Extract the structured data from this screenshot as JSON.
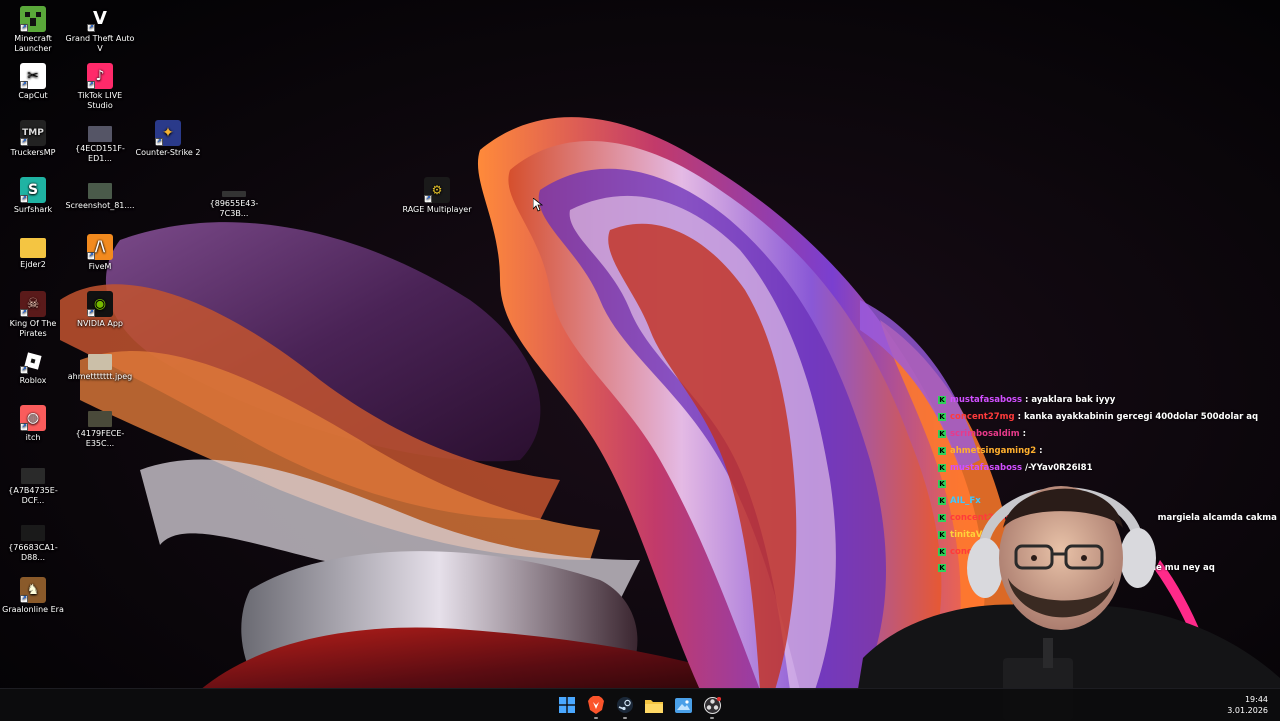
{
  "desktop": {
    "icons": [
      {
        "label": "Minecraft Launcher",
        "icon": "minecraft-icon"
      },
      {
        "label": "Grand Theft Auto V",
        "icon": "gta5-icon"
      },
      {
        "label": "CapCut",
        "icon": "capcut-icon"
      },
      {
        "label": "TikTok LIVE Studio",
        "icon": "tiktok-live-icon"
      },
      {
        "label": "TruckersMP",
        "icon": "truckersmp-icon"
      },
      {
        "label": "{4ECD151F-ED1...",
        "icon": "image-file-icon"
      },
      {
        "label": "Counter-Strike 2",
        "icon": "cs2-icon"
      },
      {
        "label": "Surfshark",
        "icon": "surfshark-icon"
      },
      {
        "label": "Screenshot_81....",
        "icon": "image-file-icon"
      },
      {
        "label": "{89655E43-7C3B...",
        "icon": "image-file-icon"
      },
      {
        "label": "RAGE Multiplayer",
        "icon": "rage-mp-icon"
      },
      {
        "label": "Ejder2",
        "icon": "folder-icon"
      },
      {
        "label": "FiveM",
        "icon": "fivem-icon"
      },
      {
        "label": "King Of The Pirates",
        "icon": "king-of-pirates-icon"
      },
      {
        "label": "NVIDIA App",
        "icon": "nvidia-icon"
      },
      {
        "label": "Roblox",
        "icon": "roblox-icon"
      },
      {
        "label": "ahmettttttt.jpeg",
        "icon": "image-file-icon"
      },
      {
        "label": "itch",
        "icon": "itch-icon"
      },
      {
        "label": "{4179FECE-E35C...",
        "icon": "image-file-icon"
      },
      {
        "label": "{A7B4735E-DCF...",
        "icon": "image-file-icon"
      },
      {
        "label": "{76683CA1-D88...",
        "icon": "image-file-icon"
      },
      {
        "label": "Graalonline Era",
        "icon": "graal-icon"
      }
    ]
  },
  "chat": {
    "messages": [
      {
        "user": "mustafasaboss",
        "text": ": ayaklara bak iyyy",
        "user_color": "#d04fff"
      },
      {
        "user": "concent27mg",
        "text": ": kanka ayakkabinin gercegi 400dolar 500dolar aq",
        "user_color": "#ff3b3b"
      },
      {
        "user": "scrimbosaldim",
        "text": ":",
        "user_color": "#e83a8a"
      },
      {
        "user": "ahmetsingaming2",
        "text": ":",
        "user_color": "#ffb02e"
      },
      {
        "user": "mustafasaboss",
        "text": "/-YYav0R26I81",
        "user_color": "#d04fff"
      },
      {
        "user": "",
        "text": "",
        "user_color": "#5b8cff"
      },
      {
        "user": "AIL_Fx",
        "text": "",
        "user_color": "#3ec8ff"
      },
      {
        "user": "concent27mg",
        "text": "",
        "user_color": "#ff3b3b"
      },
      {
        "user": "tinitaVol",
        "text": "",
        "user_color": "#ffd23a"
      },
      {
        "user": "concent27",
        "text": "",
        "user_color": "#ff3b3b"
      },
      {
        "user": "",
        "text": "",
        "user_color": "#ff3b3b"
      }
    ],
    "overflow_text_1": "margiela alcamda cakma bulamadim",
    "overflow_text_2": "ne mu ney aq"
  },
  "taskbar": {
    "apps": [
      {
        "name": "start",
        "icon": "windows-start-icon"
      },
      {
        "name": "brave",
        "icon": "brave-browser-icon"
      },
      {
        "name": "steam",
        "icon": "steam-icon"
      },
      {
        "name": "explorer",
        "icon": "file-explorer-icon"
      },
      {
        "name": "photos",
        "icon": "photos-app-icon"
      },
      {
        "name": "obs",
        "icon": "obs-studio-icon"
      }
    ],
    "time": "19:44",
    "date": "3.01.2026"
  }
}
